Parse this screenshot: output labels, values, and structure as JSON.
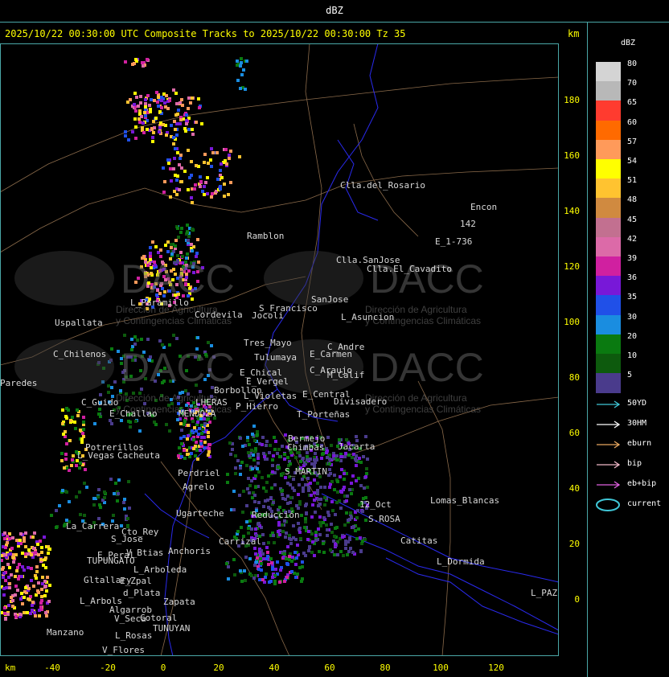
{
  "header": {
    "window_title": "dBZ"
  },
  "map": {
    "title": "2025/10/22 00:30:00 UTC Composite Tracks to 2025/10/22 00:30:00 Tz 35",
    "unit_label": "km",
    "y_ticks": [
      "180",
      "160",
      "140",
      "120",
      "100",
      "80",
      "60",
      "40",
      "20",
      "0"
    ],
    "x_ticks": [
      "-40",
      "-20",
      "0",
      "20",
      "40",
      "60",
      "80",
      "100",
      "120"
    ],
    "watermark": "DACC",
    "watermark_sub": [
      "Dirección de Agricultura",
      "y Contingencias Climáticas"
    ],
    "places": [
      {
        "name": "Clla.del_Rosario",
        "x": 423,
        "y": 230
      },
      {
        "name": "Encon",
        "x": 585,
        "y": 257
      },
      {
        "name": "E_1-736",
        "x": 541,
        "y": 300
      },
      {
        "name": "142",
        "x": 572,
        "y": 278
      },
      {
        "name": "Ramblon",
        "x": 307,
        "y": 293
      },
      {
        "name": "Clla.SanJose",
        "x": 418,
        "y": 323
      },
      {
        "name": "Clla.El_Cavadito",
        "x": 456,
        "y": 334
      },
      {
        "name": "SanJose",
        "x": 387,
        "y": 372
      },
      {
        "name": "S_Francisco",
        "x": 322,
        "y": 383
      },
      {
        "name": "L_Asuncion",
        "x": 424,
        "y": 394
      },
      {
        "name": "L_Paramillo",
        "x": 162,
        "y": 376
      },
      {
        "name": "Uspallata",
        "x": 68,
        "y": 401
      },
      {
        "name": "Cordevila",
        "x": 242,
        "y": 391
      },
      {
        "name": "Jocoli",
        "x": 313,
        "y": 392
      },
      {
        "name": "Tres_Mayo",
        "x": 303,
        "y": 426
      },
      {
        "name": "C_Andre",
        "x": 407,
        "y": 431
      },
      {
        "name": "E_Carmen",
        "x": 385,
        "y": 440
      },
      {
        "name": "C_Chilenos",
        "x": 66,
        "y": 440
      },
      {
        "name": "Tulumaya",
        "x": 316,
        "y": 444
      },
      {
        "name": "C_Araujo",
        "x": 385,
        "y": 460
      },
      {
        "name": "M_Calif",
        "x": 407,
        "y": 466
      },
      {
        "name": "E_Chical",
        "x": 298,
        "y": 463
      },
      {
        "name": "E_Vergel",
        "x": 306,
        "y": 474
      },
      {
        "name": "Paredes",
        "x": 0,
        "y": 476
      },
      {
        "name": "Borbollon",
        "x": 266,
        "y": 485
      },
      {
        "name": "L_Violetas",
        "x": 303,
        "y": 492
      },
      {
        "name": "E_Central",
        "x": 376,
        "y": 490
      },
      {
        "name": "Divisadero",
        "x": 415,
        "y": 499
      },
      {
        "name": "C_Guido",
        "x": 101,
        "y": 500
      },
      {
        "name": "P_Hierro",
        "x": 293,
        "y": 505
      },
      {
        "name": "E_Challao",
        "x": 136,
        "y": 514
      },
      {
        "name": "LHERAS",
        "x": 243,
        "y": 500
      },
      {
        "name": "MENDOZA",
        "x": 222,
        "y": 514
      },
      {
        "name": "T_Porteñas",
        "x": 369,
        "y": 515
      },
      {
        "name": "Bermejo",
        "x": 358,
        "y": 545
      },
      {
        "name": "Chimbas",
        "x": 357,
        "y": 556
      },
      {
        "name": "Jacarta",
        "x": 420,
        "y": 555
      },
      {
        "name": "Potrerillos",
        "x": 106,
        "y": 556
      },
      {
        "name": "L_Vegas",
        "x": 96,
        "y": 566
      },
      {
        "name": "Cacheuta",
        "x": 146,
        "y": 566
      },
      {
        "name": "S_MARTIN",
        "x": 354,
        "y": 586
      },
      {
        "name": "Perdriel",
        "x": 221,
        "y": 588
      },
      {
        "name": "Agrelo",
        "x": 227,
        "y": 605
      },
      {
        "name": "Reducción",
        "x": 313,
        "y": 640
      },
      {
        "name": "Lomas_Blancas",
        "x": 535,
        "y": 622
      },
      {
        "name": "12_Oct",
        "x": 447,
        "y": 627
      },
      {
        "name": "S.ROSA",
        "x": 458,
        "y": 645
      },
      {
        "name": "Ugarteche",
        "x": 219,
        "y": 638
      },
      {
        "name": "Catitas",
        "x": 498,
        "y": 672
      },
      {
        "name": "La_Carrera",
        "x": 82,
        "y": 654
      },
      {
        "name": "Cto_Rey",
        "x": 151,
        "y": 661
      },
      {
        "name": "S_Jose",
        "x": 138,
        "y": 670
      },
      {
        "name": "Carrizal",
        "x": 272,
        "y": 673
      },
      {
        "name": "Anchoris",
        "x": 209,
        "y": 685
      },
      {
        "name": "L_Dormida",
        "x": 543,
        "y": 698
      },
      {
        "name": "E_Peral",
        "x": 121,
        "y": 690
      },
      {
        "name": "V_Btias",
        "x": 157,
        "y": 687
      },
      {
        "name": "TUPUNGATO",
        "x": 108,
        "y": 697
      },
      {
        "name": "L_Arboleda",
        "x": 166,
        "y": 708
      },
      {
        "name": "Gltallary",
        "x": 104,
        "y": 721
      },
      {
        "name": "E_Zpal",
        "x": 149,
        "y": 722
      },
      {
        "name": "d_Plata",
        "x": 153,
        "y": 737
      },
      {
        "name": "L_Arbols",
        "x": 99,
        "y": 747
      },
      {
        "name": "Zapata",
        "x": 203,
        "y": 748
      },
      {
        "name": "Algarrob",
        "x": 136,
        "y": 758
      },
      {
        "name": "V_Seca",
        "x": 142,
        "y": 769
      },
      {
        "name": "Cotoral",
        "x": 174,
        "y": 768
      },
      {
        "name": "TUNUYAN",
        "x": 190,
        "y": 781
      },
      {
        "name": "Manzano",
        "x": 58,
        "y": 786
      },
      {
        "name": "L_Rosas",
        "x": 143,
        "y": 790
      },
      {
        "name": "V_Flores",
        "x": 127,
        "y": 808
      },
      {
        "name": "L_PAZ",
        "x": 660,
        "y": 737
      }
    ]
  },
  "legend": {
    "title": "dBZ",
    "scale": [
      {
        "label": "80",
        "color": "#d4d4d4"
      },
      {
        "label": "70",
        "color": "#b8b8b8"
      },
      {
        "label": "65",
        "color": "#ff3b2f"
      },
      {
        "label": "60",
        "color": "#ff6a00"
      },
      {
        "label": "57",
        "color": "#ff9a5a"
      },
      {
        "label": "54",
        "color": "#ffff00"
      },
      {
        "label": "51",
        "color": "#ffc330"
      },
      {
        "label": "48",
        "color": "#d08a40"
      },
      {
        "label": "45",
        "color": "#c27090"
      },
      {
        "label": "42",
        "color": "#dc6aa8"
      },
      {
        "label": "39",
        "color": "#d020a0"
      },
      {
        "label": "36",
        "color": "#7818d8"
      },
      {
        "label": "35",
        "color": "#2050e8"
      },
      {
        "label": "30",
        "color": "#1a8de0"
      },
      {
        "label": "20",
        "color": "#0a7a10"
      },
      {
        "label": "10",
        "color": "#0d5a0d"
      },
      {
        "label": "5",
        "color": "#4a3b8c"
      }
    ],
    "tracks": [
      {
        "label": "50YD",
        "color": "#40c8d8"
      },
      {
        "label": "30HM",
        "color": "#ffffff"
      },
      {
        "label": "eburn",
        "color": "#e8a860"
      },
      {
        "label": "bip",
        "color": "#f0b8c8"
      },
      {
        "label": "eb+bip",
        "color": "#e060e0"
      },
      {
        "label": "current",
        "color": "#40c8d8"
      }
    ]
  }
}
